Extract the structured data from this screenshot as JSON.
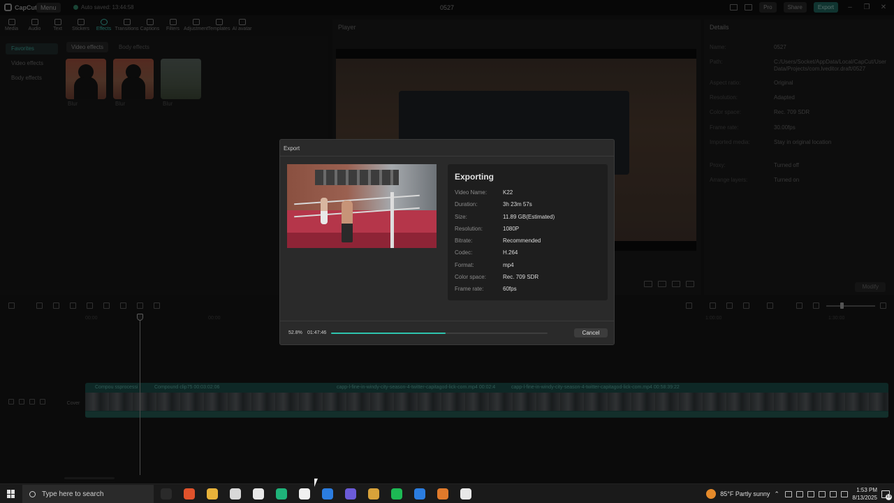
{
  "titlebar": {
    "app_name": "CapCut",
    "menu_label": "Menu",
    "autosave": "Auto saved: 13:44:58",
    "project_title": "0527",
    "pro_label": "Pro",
    "share_label": "Share",
    "export_label": "Export"
  },
  "tools": [
    {
      "label": "Media"
    },
    {
      "label": "Audio"
    },
    {
      "label": "Text"
    },
    {
      "label": "Stickers"
    },
    {
      "label": "Effects"
    },
    {
      "label": "Transitions"
    },
    {
      "label": "Captions"
    },
    {
      "label": "Filters"
    },
    {
      "label": "Adjustment"
    },
    {
      "label": "Templates"
    },
    {
      "label": "AI avatar"
    }
  ],
  "left_panel": {
    "side_items": [
      "Favorites",
      "Video effects",
      "Body effects"
    ],
    "sub_tabs": [
      "Video effects",
      "Body effects"
    ],
    "thumb_labels": [
      "Blur",
      "Blur",
      "Blur"
    ]
  },
  "player": {
    "title": "Player"
  },
  "details": {
    "title": "Details",
    "rows": [
      {
        "k": "Name:",
        "v": "0527"
      },
      {
        "k": "Path:",
        "v": "C:/Users/Socket/AppData/Local/CapCut/User Data/Projects/com.lveditor.draft/0527"
      },
      {
        "k": "Aspect ratio:",
        "v": "Original"
      },
      {
        "k": "Resolution:",
        "v": "Adapted"
      },
      {
        "k": "Color space:",
        "v": "Rec. 709 SDR"
      },
      {
        "k": "Frame rate:",
        "v": "30.00fps"
      },
      {
        "k": "Imported media:",
        "v": "Stay in original location"
      },
      {
        "k": "Proxy:",
        "v": "Turned off"
      },
      {
        "k": "Arrange layers:",
        "v": "Turned on"
      }
    ],
    "modify_label": "Modify"
  },
  "timeline": {
    "ruler": [
      "00:00",
      "00:00",
      "1:00:00",
      "1:30:00"
    ],
    "cover_label": "Cover",
    "clip_labels": [
      "Compou  ssprocessi",
      "Compound clip75  00:03:02:06",
      "capp-l-fine-in-windy-city-season-4-twitter-capitagod-lick-com.mp4  00:02:4",
      "capp-l-fine-in-windy-city-season-4-twitter-capitagod-lick-com.mp4  00:58:39:22"
    ]
  },
  "export_dialog": {
    "title": "Export",
    "heading": "Exporting",
    "info": [
      {
        "k": "Video Name:",
        "v": "K22"
      },
      {
        "k": "Duration:",
        "v": "3h 23m 57s"
      },
      {
        "k": "Size:",
        "v": "11.89 GB(Estimated)"
      },
      {
        "k": "Resolution:",
        "v": "1080P"
      },
      {
        "k": "Bitrate:",
        "v": "Recommended"
      },
      {
        "k": "Codec:",
        "v": "H.264"
      },
      {
        "k": "Format:",
        "v": "mp4"
      },
      {
        "k": "Color space:",
        "v": "Rec. 709 SDR"
      },
      {
        "k": "Frame rate:",
        "v": "60fps"
      }
    ],
    "progress_percent_label": "52.8%",
    "progress_fraction": 0.528,
    "elapsed": "01:47:46",
    "cancel_label": "Cancel",
    "accent": "#2ec4ae"
  },
  "taskbar": {
    "search_placeholder": "Type here to search",
    "apps": [
      {
        "name": "task-view-icon",
        "color": "#2a2a2a"
      },
      {
        "name": "brave-icon",
        "color": "#e0522b"
      },
      {
        "name": "file-explorer-icon",
        "color": "#e8b23a"
      },
      {
        "name": "chrome-icon",
        "color": "#d8d8d8"
      },
      {
        "name": "capcut-icon",
        "color": "#e8e8e8"
      },
      {
        "name": "app-green-icon",
        "color": "#1fb37a"
      },
      {
        "name": "x-icon",
        "color": "#f0f0f0"
      },
      {
        "name": "app-blue-icon",
        "color": "#2b7de0"
      },
      {
        "name": "app-purple-icon",
        "color": "#6b5bd8"
      },
      {
        "name": "app-gold-icon",
        "color": "#d8a23a"
      },
      {
        "name": "spotify-icon",
        "color": "#1db954"
      },
      {
        "name": "app-s-icon",
        "color": "#2b7de0"
      },
      {
        "name": "app-orange-icon",
        "color": "#e07a2b"
      },
      {
        "name": "capcut-active-icon",
        "color": "#e8e8e8"
      }
    ],
    "weather": "85°F  Partly sunny",
    "time": "1:53 PM",
    "date": "8/13/2025",
    "notification_count": "13"
  }
}
